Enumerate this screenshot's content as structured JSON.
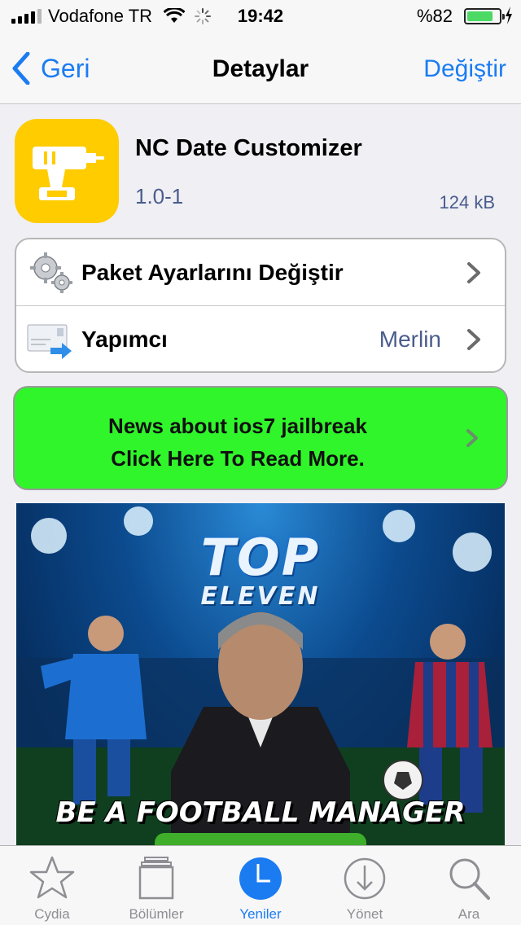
{
  "status_bar": {
    "carrier": "Vodafone TR",
    "time": "19:42",
    "battery_percent": "%82",
    "battery_level": 0.82
  },
  "nav": {
    "back_label": "Geri",
    "title": "Detaylar",
    "edit_label": "Değiştir"
  },
  "package": {
    "name": "NC Date Customizer",
    "version": "1.0-1",
    "size": "124 kB",
    "icon": "drill-icon"
  },
  "list": {
    "items": [
      {
        "label": "Paket Ayarlarını Değiştir",
        "value": "",
        "icon": "gears-icon"
      },
      {
        "label": "Yapımcı",
        "value": "Merlin",
        "icon": "mail-forward-icon"
      }
    ]
  },
  "news": {
    "line1": "News about ios7 jailbreak",
    "line2": "Click Here To Read More."
  },
  "ad": {
    "logo_top": "TOP",
    "logo_bottom": "ELEVEN",
    "slogan": "BE A FOOTBALL MANAGER"
  },
  "tabs": [
    {
      "label": "Cydia",
      "icon": "star-icon",
      "active": false
    },
    {
      "label": "Bölümler",
      "icon": "sections-icon",
      "active": false
    },
    {
      "label": "Yeniler",
      "icon": "clock-icon",
      "active": true
    },
    {
      "label": "Yönet",
      "icon": "download-icon",
      "active": false
    },
    {
      "label": "Ara",
      "icon": "search-icon",
      "active": false
    }
  ],
  "colors": {
    "accent": "#1b7cf2",
    "icon_bg": "#ffcc00",
    "news_bg": "#30f52b",
    "battery": "#4cd964"
  }
}
